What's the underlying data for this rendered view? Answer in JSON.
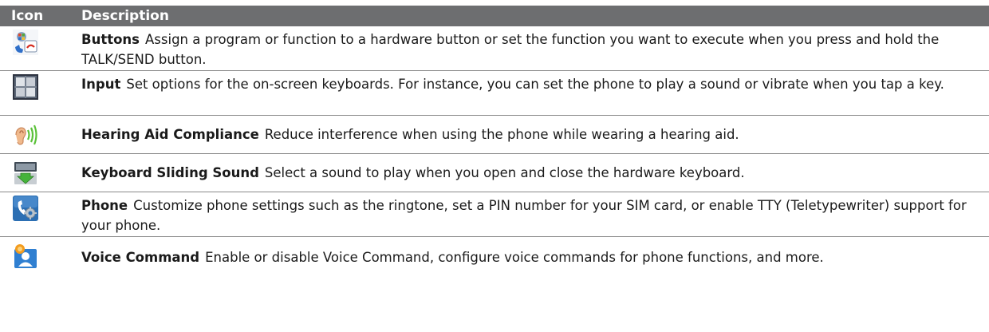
{
  "table": {
    "header": {
      "icon": "Icon",
      "description": "Description"
    },
    "rows": [
      {
        "icon": "buttons-icon",
        "term": "Buttons",
        "text": "Assign a program or function to a hardware button or set the function you want to execute when you press and hold the TALK/SEND button."
      },
      {
        "icon": "input-icon",
        "term": "Input",
        "text": "Set options for the on-screen keyboards. For instance, you can set the phone to play a sound or vibrate when you tap a key."
      },
      {
        "icon": "hearing-aid-icon",
        "term": "Hearing Aid Compliance",
        "text": "Reduce interference when using the phone while wearing a hearing aid."
      },
      {
        "icon": "keyboard-sliding-icon",
        "term": "Keyboard Sliding Sound",
        "text": "Select a sound to play when you open and close the hardware keyboard."
      },
      {
        "icon": "phone-settings-icon",
        "term": "Phone",
        "text": "Customize phone settings such as the ringtone, set a PIN number for your SIM card, or enable TTY (Teletypewriter) support for your phone."
      },
      {
        "icon": "voice-command-icon",
        "term": "Voice Command",
        "text": "Enable or disable Voice Command, configure voice commands for phone functions, and more."
      }
    ]
  }
}
